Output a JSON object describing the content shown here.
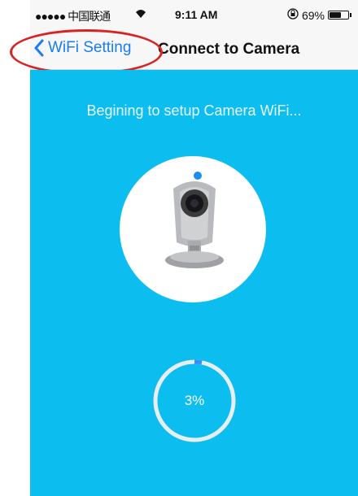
{
  "status_bar": {
    "carrier": "●●●●● 中国联通",
    "time": "9:11 AM",
    "battery_percent": 69,
    "battery_text": "69%"
  },
  "nav": {
    "back_label": "WiFi Setting",
    "title": "Connect to Camera"
  },
  "content": {
    "heading": "Begining to setup Camera WiFi...",
    "progress": 0.03,
    "progress_text": "3%"
  },
  "colors": {
    "accent": "#0cbdf0",
    "link": "#1a7cf2",
    "annotation": "#d92323",
    "progress_track": "#e6eef2",
    "progress_fill": "#3a8bff"
  },
  "icons": [
    "wifi-icon",
    "rotation-lock-icon",
    "battery-icon",
    "back-chevron-icon",
    "camera-icon",
    "progress-ring"
  ]
}
